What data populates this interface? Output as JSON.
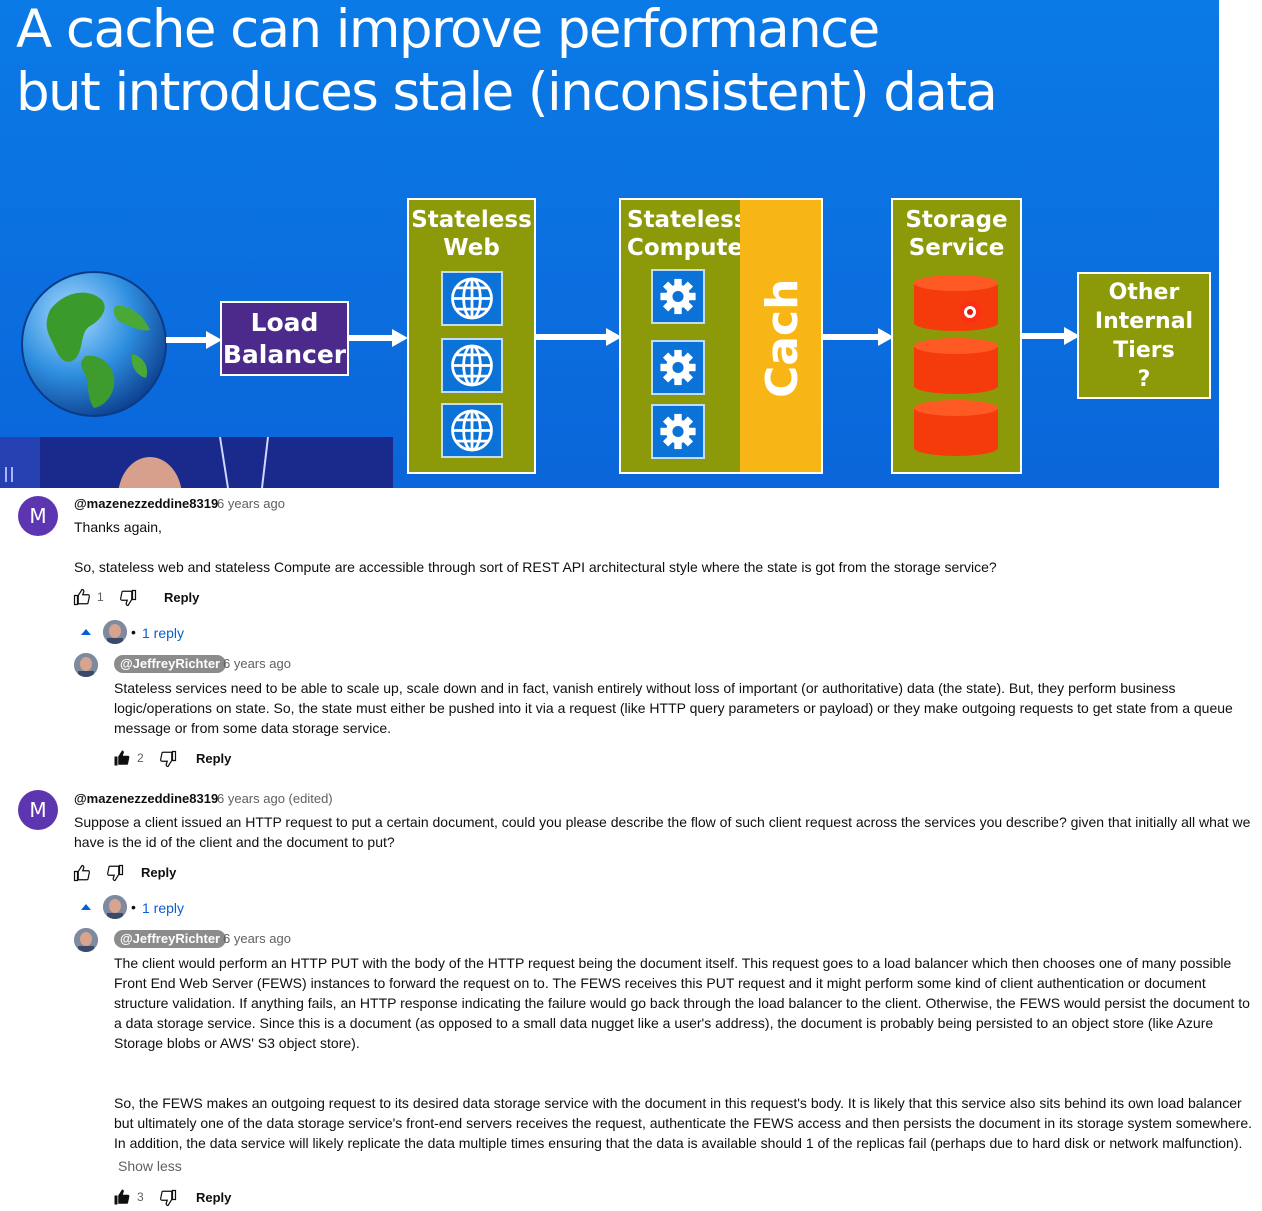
{
  "slide": {
    "title_line1": "A cache can improve performance",
    "title_line2": "but introduces stale (inconsistent) data",
    "load_balancer": [
      "Load",
      "Balancer"
    ],
    "stateless_web": [
      "Stateless",
      "Web"
    ],
    "stateless_compute": [
      "Stateless",
      "Compute"
    ],
    "cache": "Cache",
    "storage_service": [
      "Storage",
      "Service"
    ],
    "other_tiers": [
      "Other",
      "Internal",
      "Tiers",
      "?"
    ]
  },
  "comments": [
    {
      "author": "@mazenezzeddine8319",
      "avatar_letter": "M",
      "time": "6 years ago",
      "text_lines": [
        "Thanks again,",
        "So, stateless web and stateless Compute are accessible through sort of REST API architectural style where the state is got from the storage service?"
      ],
      "likes": "1",
      "reply_label": "Reply",
      "replies_label": "1 reply",
      "reply": {
        "author": "@JeffreyRichter",
        "time": "6 years ago",
        "text": "Stateless services need to be able to scale up, scale down and in fact, vanish entirely without loss of important (or authoritative) data (the state). But, they perform business logic/operations on state. So, the state must either be pushed into it via a request (like HTTP query parameters or payload) or they make outgoing requests to get state from a queue message or from some data storage service.",
        "likes": "2",
        "reply_label": "Reply"
      }
    },
    {
      "author": "@mazenezzeddine8319",
      "avatar_letter": "M",
      "time": "6 years ago (edited)",
      "text": "Suppose a client issued an HTTP request to put a certain document, could you please describe the flow of such client request across the services you describe? given that initially all what we have is the id of the client and the document to put?",
      "reply_label": "Reply",
      "replies_label": "1 reply",
      "reply": {
        "author": "@JeffreyRichter",
        "time": "6 years ago",
        "text_p1": "The client would perform an HTTP PUT with the body of the HTTP request being the document itself. This request goes to a load balancer which then chooses one of many possible Front End Web Server (FEWS) instances to forward the request on to. The FEWS receives this PUT request and it might perform some kind of client authentication or document structure validation. If anything fails, an HTTP response indicating the failure would go back through the load balancer to the client. Otherwise, the FEWS would persist the document to a data storage service. Since this is a document (as opposed to a small data nugget like a user's address), the document is probably being persisted to an object store (like Azure Storage blobs or AWS' S3 object store).",
        "text_p2": "So, the FEWS makes an outgoing request to its desired data storage service with the document in this request's body. It is likely that this service also sits behind its own load balancer but ultimately one of the data storage service's front-end servers receives the request, authenticate the FEWS access and then persists the document in its storage system somewhere. In addition, the data service will likely replicate the data multiple times ensuring that the data is available should 1 of the replicas fail (perhaps due to hard disk or network malfunction).",
        "show_less": "Show less",
        "likes": "3",
        "reply_label": "Reply"
      }
    }
  ],
  "colors": {
    "slide_blue": "#0b6fe0",
    "olive": "#8c9a0a",
    "purple": "#4b2a8c",
    "cache_yellow": "#f8b616",
    "storage_red": "#f53b0c",
    "avatar_purple": "#5e35b1",
    "link_blue": "#065fd4"
  },
  "icons": [
    "globe-icon",
    "web-globe-icon",
    "gear-icon",
    "database-icon",
    "thumb-up-icon",
    "thumb-down-icon",
    "caret-up-icon"
  ]
}
